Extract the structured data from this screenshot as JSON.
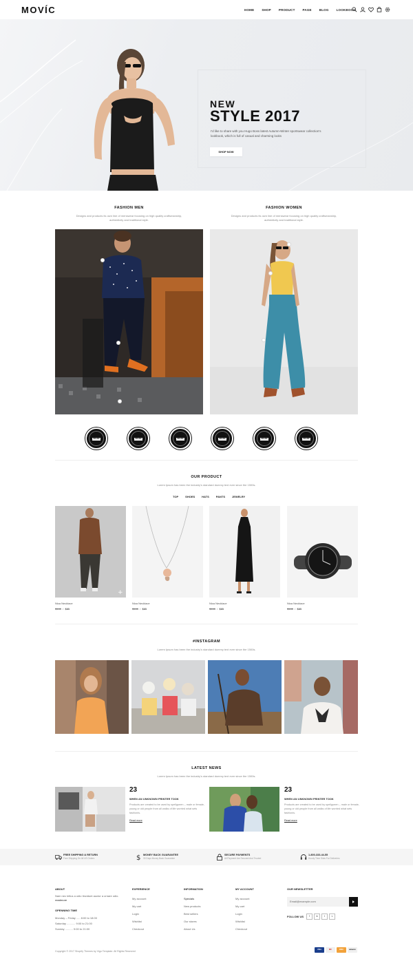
{
  "header": {
    "logo": "MOVÍC",
    "nav": [
      "HOME",
      "SHOP",
      "PRODUCT",
      "PAGE",
      "BLOG",
      "LOOKBOOK"
    ],
    "icons": [
      "search-icon",
      "user-icon",
      "heart-icon",
      "cart-icon",
      "gear-icon"
    ]
  },
  "hero": {
    "line1": "NEW",
    "line2": "STYLE 2017",
    "description": "I'd like to share with you Hugo Boss latest Autumn-Winter sportswear collection's lookbook, which is full of casual and charming looks",
    "button": "SHOP NOW"
  },
  "fashion": {
    "men": {
      "title": "FASHION MEN",
      "subtitle": "Designs and products its own line of menswear focusing on high quality craftsmanship, authenticity and traditional style."
    },
    "women": {
      "title": "FASHION WOMEN",
      "subtitle": "Designs and products its own line of menswear focusing on high quality craftsmanship, authenticity and traditional style."
    }
  },
  "brands": [
    "BRAND",
    "BRAND",
    "BRAND",
    "BRAND",
    "BRAND",
    "BRAND"
  ],
  "products": {
    "title": "OUR PRODUCT",
    "subtitle": "Lorem Ipsum has been the industry's standard dummy text ever since the 1500s.",
    "tabs": [
      "TOP",
      "SHOES",
      "HATS",
      "PANTS",
      "JEWELRY"
    ],
    "items": [
      {
        "name": "Nica Necklace",
        "old_price": "$145",
        "price": "$85"
      },
      {
        "name": "Nica Necklace",
        "old_price": "$145",
        "price": "$85"
      },
      {
        "name": "Nica Necklace",
        "old_price": "$145",
        "price": "$85"
      },
      {
        "name": "Nica Necklace",
        "old_price": "$145",
        "price": "$85"
      }
    ]
  },
  "instagram": {
    "title": "#INSTAGRAM",
    "subtitle": "Lorem Ipsum has been the industry's standard dummy text ever since the 1500s."
  },
  "news": {
    "title": "LATEST NEWS",
    "subtitle": "Lorem Ipsum has been the industry's standard dummy text ever since the 1500s.",
    "posts": [
      {
        "day": "23",
        "title": "WHEN AN UNKNOWN PRINTER TOOK",
        "text": "Products are created to be used by spellgueen – male or female, young or old people from all walks of life worried what sets fashionis.",
        "more": "Read more"
      },
      {
        "day": "23",
        "title": "WHEN AN UNKNOWN PRINTER TOOK",
        "text": "Products are created to be used by spellgueen – male or female, young or old people from all walks of life worried what sets fashionis.",
        "more": "Read more"
      }
    ]
  },
  "services": [
    {
      "icon": "truck-icon",
      "title": "FREE SHIPPING & RETURN",
      "sub": "Free Shipping On All US Orders"
    },
    {
      "icon": "dollar-icon",
      "title": "MONEY BACK GUARANTEE",
      "sub": "30 Days Money Back Guarantee"
    },
    {
      "icon": "lock-icon",
      "title": "SECURE PAYMENTS",
      "sub": "All Payment Are Secured And Trusted"
    },
    {
      "icon": "headset-icon",
      "title": "1-800-333-44-55",
      "sub": "Hourly Time Slots For Deliveries"
    }
  ],
  "footer": {
    "about": {
      "title": "ABOUT",
      "text": "Nam nec tellus a odio tincidunt auctor a ornare odio.",
      "link": "readmore",
      "hours_title": "OPENNING TIME",
      "hours": [
        "Monday – Friday ..... 8:00 to 18:00",
        "Saturday ........... 9:00 to 21:00",
        "Sunday .......... 9:00 to 21:00"
      ]
    },
    "experience": {
      "title": "EXPERIENCE",
      "links": [
        "My account",
        "My cart",
        "Login",
        "Wishlist",
        "Checkout"
      ]
    },
    "information": {
      "title": "INFORMATION",
      "links": [
        "Specials",
        "New products",
        "Best sellers",
        "Our stores",
        "About Us"
      ]
    },
    "account": {
      "title": "MY ACCOUNT",
      "links": [
        "My account",
        "My cart",
        "Login",
        "Wishlist",
        "Checkout"
      ]
    },
    "newsletter": {
      "title": "OUR NEWSLETTER",
      "placeholder": "Email@example.com",
      "follow": "FOLLOW US",
      "social": [
        "f",
        "in",
        "t",
        "v"
      ]
    },
    "copyright": "Copyright © 2017 Shopify Themes by Vigo Template. All Rights Reserved",
    "payments": [
      "VISA",
      "MC",
      "DISC",
      "amazon"
    ]
  }
}
